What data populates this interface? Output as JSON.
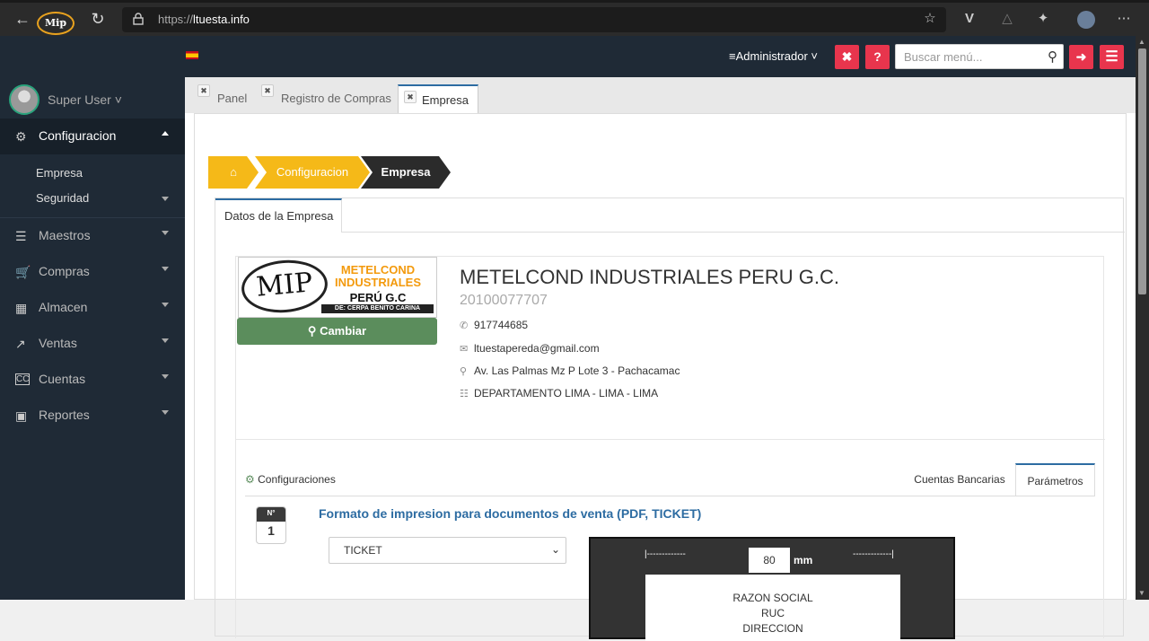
{
  "browser": {
    "url_prefix": "https://",
    "url_host": "ltuesta.info"
  },
  "topbar": {
    "logo_text": "Mip",
    "admin_label": "Administrador",
    "search_placeholder": "Buscar menú..."
  },
  "sidebar": {
    "user_name": "Super User",
    "items": [
      {
        "label": "Configuracion",
        "icon": "gears-icon"
      },
      {
        "label": "Maestros",
        "icon": "list-icon"
      },
      {
        "label": "Compras",
        "icon": "cart-icon"
      },
      {
        "label": "Almacen",
        "icon": "building-icon"
      },
      {
        "label": "Ventas",
        "icon": "chart-line-icon"
      },
      {
        "label": "Cuentas",
        "icon": "cc-icon"
      },
      {
        "label": "Reportes",
        "icon": "book-icon"
      }
    ],
    "subitems": [
      "Empresa",
      "Seguridad"
    ]
  },
  "tabs": [
    "Panel",
    "Registro de Compras",
    "Empresa"
  ],
  "breadcrumb": [
    "Configuracion",
    "Empresa"
  ],
  "panel_tab": "Datos de la Empresa",
  "company": {
    "logo_line1": "METELCOND",
    "logo_line2": "INDUSTRIALES",
    "logo_line3": "PERÚ G.C",
    "logo_line4": "DE: CERPA BENITO CARINA",
    "change_button": "Cambiar",
    "name": "METELCOND INDUSTRIALES PERU G.C.",
    "ruc": "20100077707",
    "phone": "917744685",
    "email": "ltuestapereda@gmail.com",
    "address": "Av. Las Palmas Mz P Lote 3 - Pachacamac",
    "location": "DEPARTAMENTO LIMA - LIMA - LIMA"
  },
  "config": {
    "title": "Configuraciones",
    "tabs": [
      "Cuentas Bancarias",
      "Parámetros"
    ],
    "number_header": "N°",
    "number_value": "1",
    "format_title": "Formato de impresion para documentos de venta (PDF, TICKET)",
    "format_value": "TICKET",
    "ticket_width": "80",
    "ticket_unit": "mm",
    "dash_left": "|-------------",
    "dash_right": "-------------|",
    "ticket_lines": [
      "RAZON SOCIAL",
      "RUC",
      "DIRECCION"
    ]
  },
  "colors": {
    "topbar_bg": "#1f2a36",
    "accent_blue": "#2d6ca2",
    "crumb_yellow": "#f5b918",
    "crumb_dark": "#2b2b2b",
    "button_red": "#e8354d",
    "button_green": "#5b8d5c"
  }
}
